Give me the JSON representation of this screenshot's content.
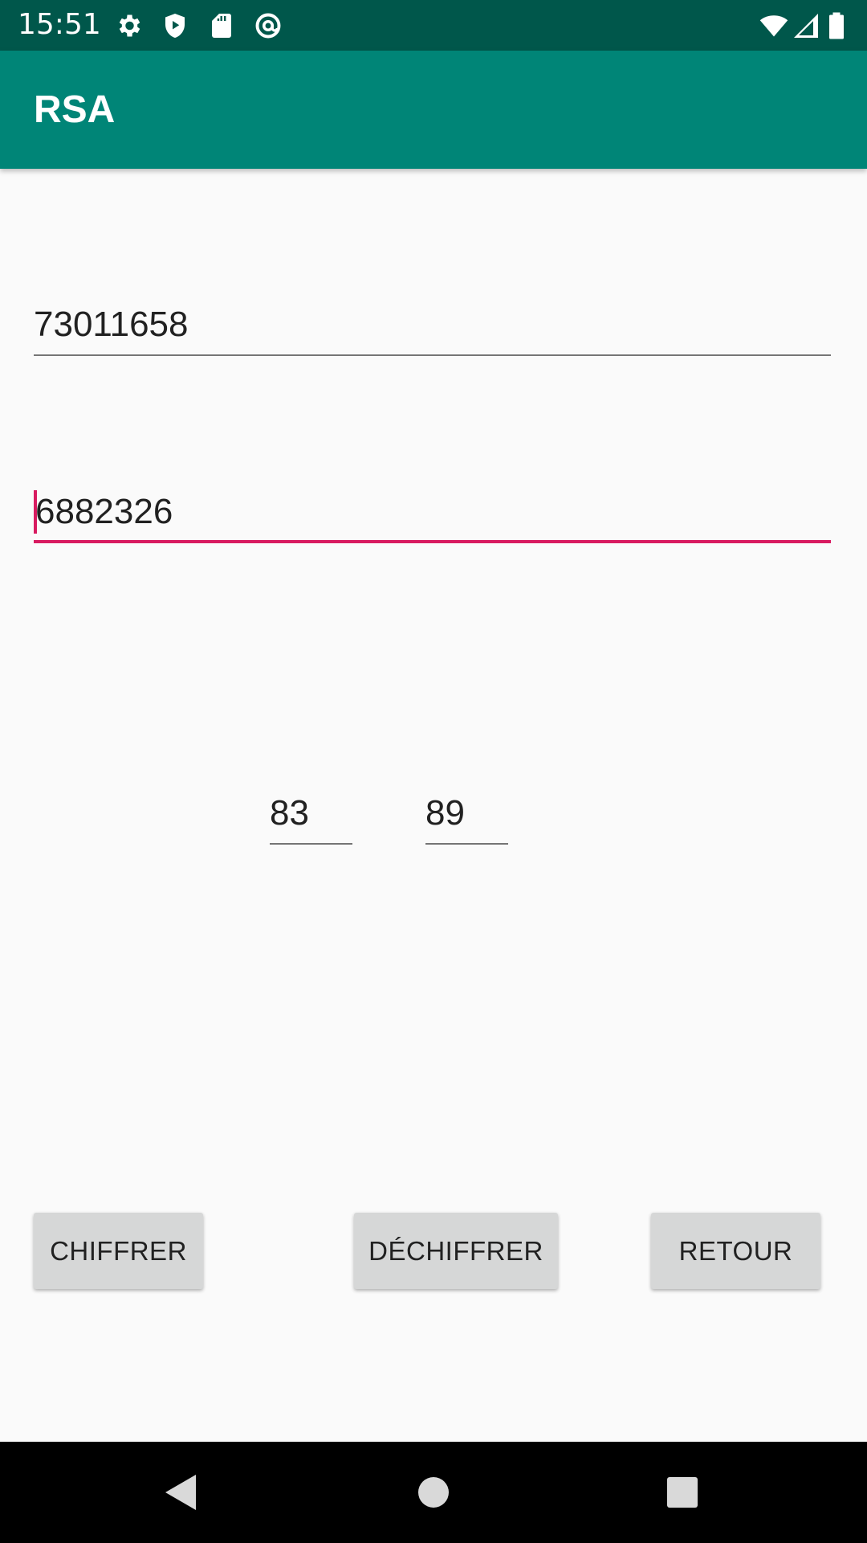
{
  "status_bar": {
    "time": "15:51",
    "icons": [
      "gear-icon",
      "shield-play-icon",
      "sd-card-icon",
      "at-sign-icon",
      "wifi-icon",
      "signal-icon",
      "battery-icon"
    ],
    "background": "#00574b"
  },
  "app_bar": {
    "title": "RSA",
    "background": "#008577"
  },
  "form": {
    "field1_value": "73011658",
    "field2_value": "6882326",
    "field3_value": "83",
    "field4_value": "89",
    "focus_color": "#d81b60"
  },
  "buttons": {
    "encrypt_label": "CHIFFRER",
    "decrypt_label": "DÉCHIFFRER",
    "back_label": "RETOUR"
  },
  "nav_bar": {
    "icons": [
      "back-triangle-icon",
      "home-circle-icon",
      "recents-square-icon"
    ]
  }
}
